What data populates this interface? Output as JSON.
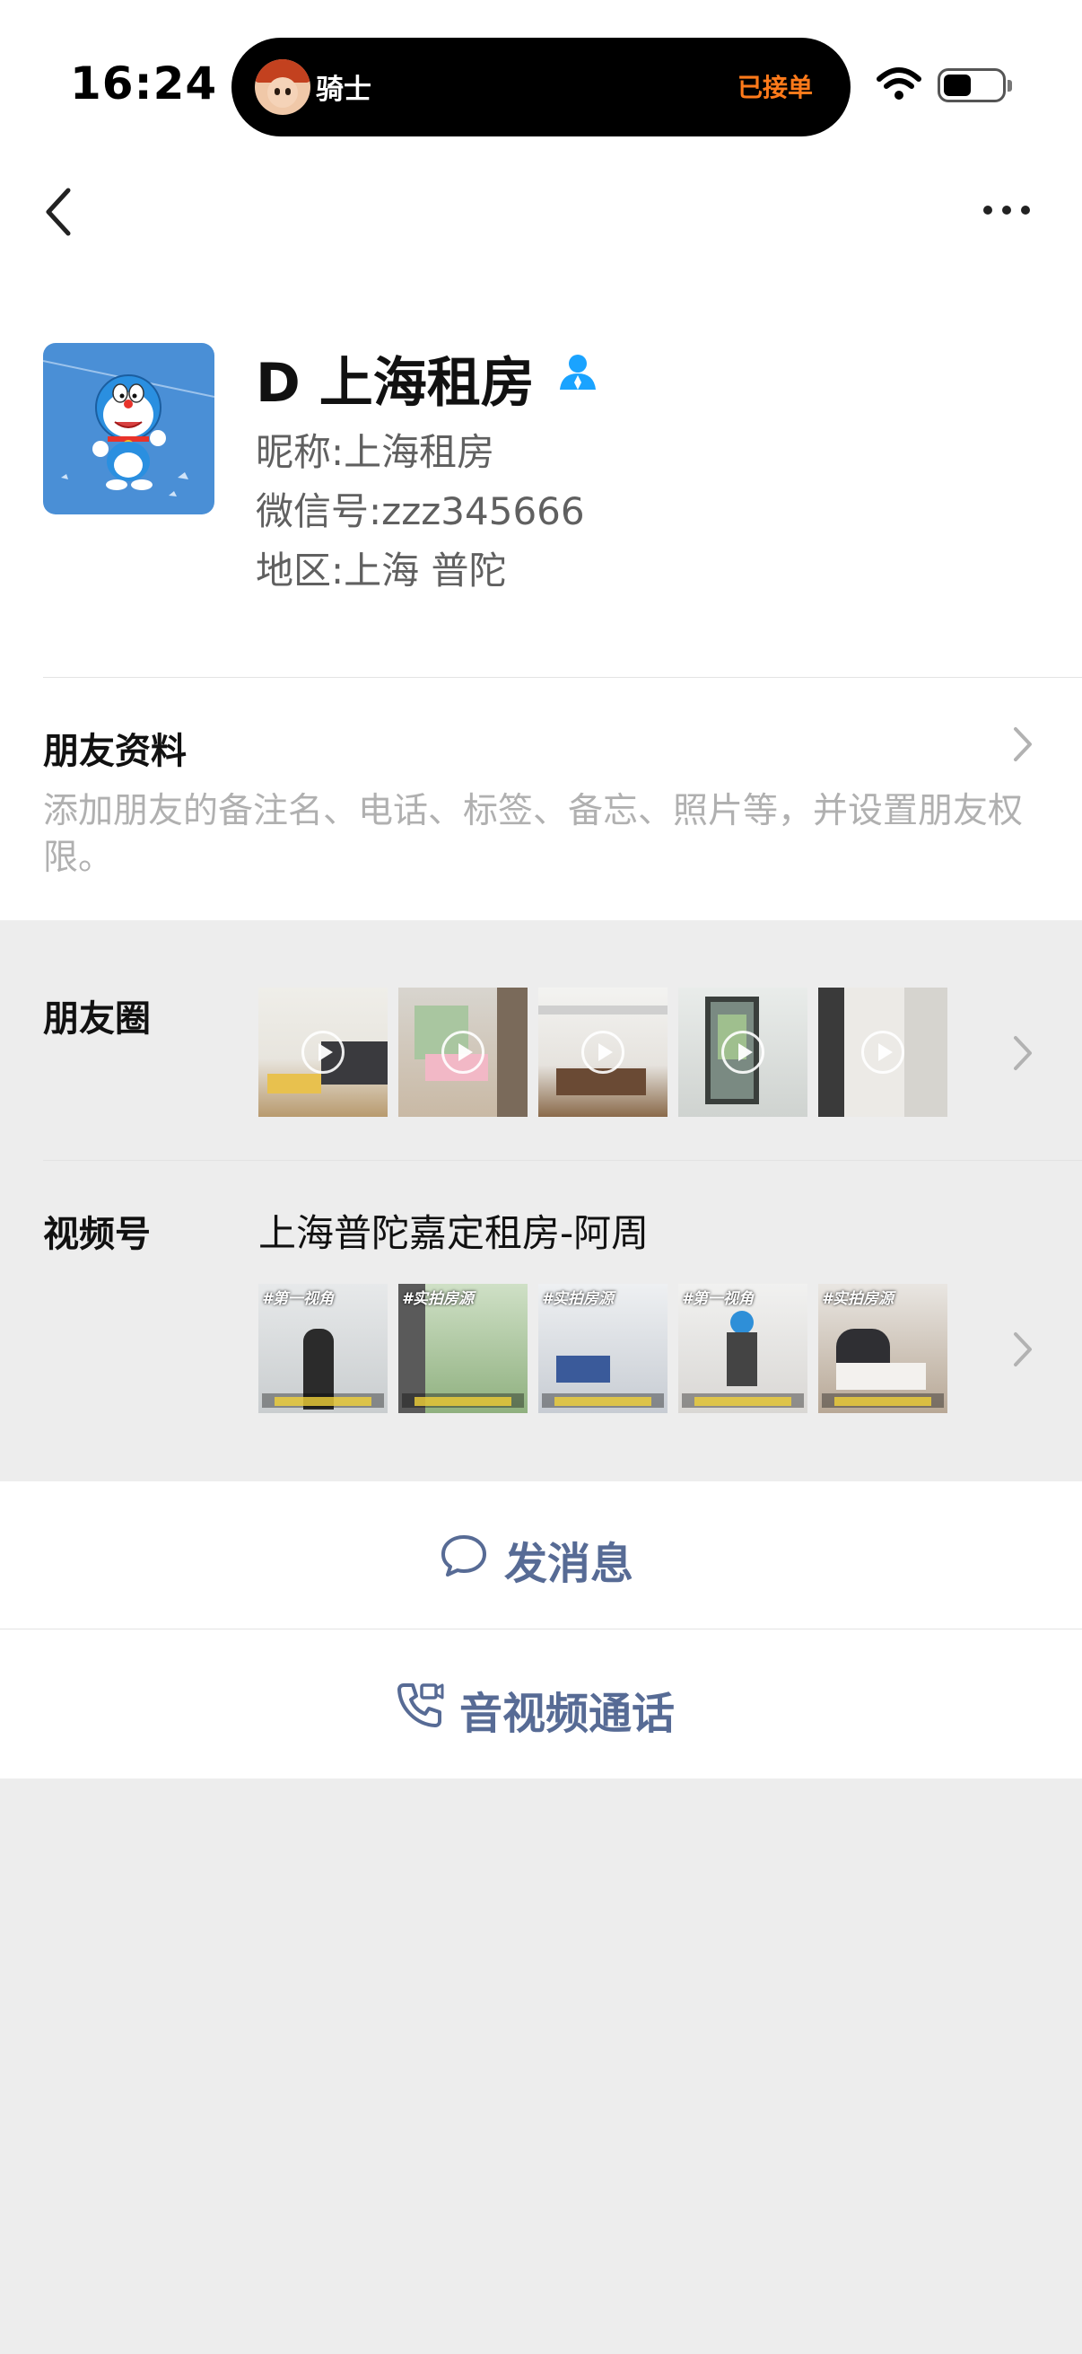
{
  "status_bar": {
    "time": "16:24",
    "island_name": "骑士",
    "island_status": "已接单",
    "wifi_icon": "wifi-icon",
    "battery_icon": "battery-icon"
  },
  "nav": {
    "back_icon": "chevron-left-icon",
    "more_icon": "more-dots-icon"
  },
  "profile": {
    "display_name": "D 上海租房",
    "nickname_line": "昵称:上海租房",
    "wechat_id_line": "微信号:zzz345666",
    "region_line": "地区:上海 普陀"
  },
  "friend_info": {
    "title": "朋友资料",
    "description": "添加朋友的备注名、电话、标签、备忘、照片等，并设置朋友权限。"
  },
  "moments": {
    "title": "朋友圈",
    "thumbnails": [
      {
        "theme": "living-room"
      },
      {
        "theme": "bedroom"
      },
      {
        "theme": "studio"
      },
      {
        "theme": "hallway-door"
      },
      {
        "theme": "corridor"
      }
    ]
  },
  "channels": {
    "title": "视频号",
    "channel_name": "上海普陀嘉定租房-阿周",
    "thumbnails": [
      {
        "tag": "#第一视角"
      },
      {
        "tag": "#实拍房源"
      },
      {
        "tag": "#实拍房源"
      },
      {
        "tag": "#第一视角"
      },
      {
        "tag": "#实拍房源"
      }
    ]
  },
  "actions": {
    "message_label": "发消息",
    "call_label": "音视频通话"
  },
  "colors": {
    "link_blue": "#576b95",
    "island_status_orange": "#ff7a1a",
    "avatar_blue": "#4a8fd6",
    "verified_blue": "#1aa3ff",
    "background_gray": "#ededed"
  }
}
